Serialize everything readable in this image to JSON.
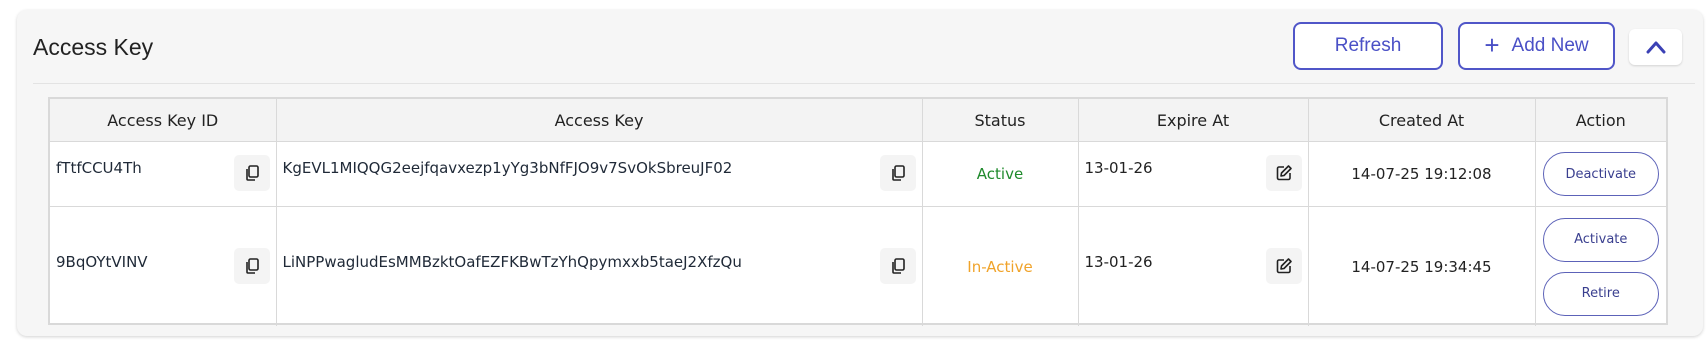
{
  "panel": {
    "title": "Access Key",
    "refresh_label": "Refresh",
    "add_new_label": "Add New",
    "collapse_icon": "chevron-up-icon"
  },
  "table": {
    "columns": [
      "Access Key ID",
      "Access Key",
      "Status",
      "Expire At",
      "Created At",
      "Action"
    ],
    "rows": [
      {
        "id": "fTtfCCU4Th",
        "key": "KgEVL1MIQQG2eejfqavxezp1yYg3bNfFJO9v7SvOkSbreuJF02",
        "status": "Active",
        "expire_at": "13-01-26",
        "created_at": "14-07-25 19:12:08",
        "actions": [
          "Deactivate"
        ]
      },
      {
        "id": "9BqOYtVINV",
        "key": "LiNPPwagludEsMMBzktOafEZFKBwTzYhQpymxxb5taeJ2XfzQu",
        "status": "In-Active",
        "expire_at": "13-01-26",
        "created_at": "14-07-25 19:34:45",
        "actions": [
          "Activate",
          "Retire"
        ]
      }
    ]
  },
  "colors": {
    "accent": "#4a50c6",
    "active": "#1f8a2c",
    "inactive": "#f0a32a"
  }
}
